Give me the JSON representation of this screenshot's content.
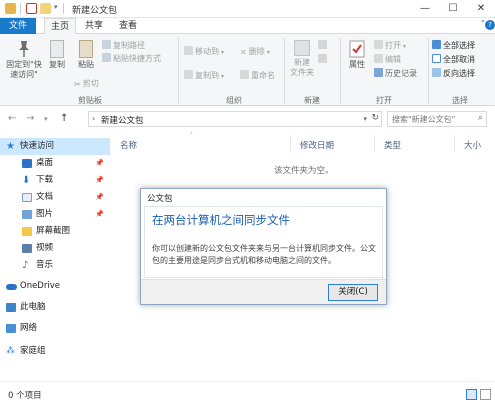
{
  "window": {
    "title": "新建公文包",
    "controls": {
      "minimize": "—",
      "maximize": "☐",
      "close": "✕"
    }
  },
  "tabs": {
    "file": "文件",
    "home": "主页",
    "share": "共享",
    "view": "查看"
  },
  "ribbon": {
    "clipboard": {
      "pin_label": "固定到\"快\n速访问\"",
      "copy_label": "复制",
      "paste_label": "粘贴",
      "copy_path": "复制路径",
      "paste_shortcut": "粘贴快捷方式",
      "cut": "剪切",
      "group_label": "剪贴板"
    },
    "organize": {
      "move_to": "移动到",
      "copy_to": "复制到",
      "delete": "删除",
      "rename": "重命名",
      "group_label": "组织"
    },
    "new": {
      "new_folder": "新建\n文件夹",
      "group_label": "新建"
    },
    "open": {
      "properties": "属性",
      "open": "打开",
      "edit": "编辑",
      "history": "历史记录",
      "group_label": "打开"
    },
    "select": {
      "select_all": "全部选择",
      "select_none": "全部取消",
      "invert": "反向选择",
      "group_label": "选择"
    }
  },
  "address": {
    "path": "新建公文包",
    "search_placeholder": "搜索\"新建公文包\""
  },
  "nav": {
    "quick_access": "快速访问",
    "desktop": "桌面",
    "downloads": "下载",
    "documents": "文档",
    "pictures": "图片",
    "screenshots": "屏幕截图",
    "videos": "视频",
    "music": "音乐",
    "onedrive": "OneDrive",
    "this_pc": "此电脑",
    "network": "网络",
    "homegroup": "家庭组"
  },
  "columns": {
    "name": "名称",
    "modified": "修改日期",
    "type": "类型",
    "size": "大小"
  },
  "content": {
    "empty_message": "该文件夹为空。"
  },
  "dialog": {
    "title": "公文包",
    "heading": "在两台计算机之间同步文件",
    "body": "你可以创建新的公文包文件夹来与另一台计算机同步文件。公文包的主要用途是同步台式机和移动电脑之间的文件。",
    "close_label": "关闭(C)"
  },
  "status": {
    "item_count": "0 个项目"
  },
  "colors": {
    "accent": "#1979ca",
    "selection": "#cce8ff",
    "dialog_heading": "#1a5fb4"
  }
}
